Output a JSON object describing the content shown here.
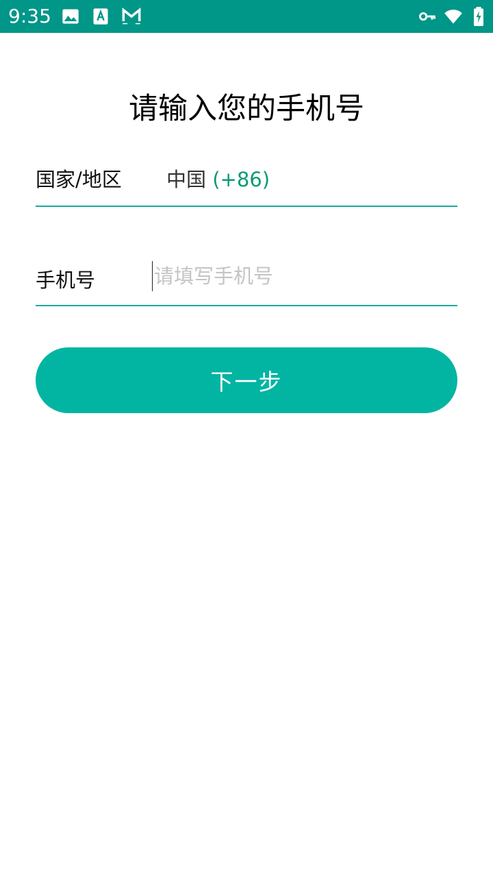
{
  "status_bar": {
    "time": "9:35",
    "background_color": "#009688",
    "left_icons": [
      "image-icon",
      "font-app-icon",
      "cat-mail-icon"
    ],
    "right_icons": [
      "vpn-key-icon",
      "wifi-icon",
      "battery-charging-icon"
    ]
  },
  "page": {
    "title": "请输入您的手机号"
  },
  "country_row": {
    "label": "国家/地区",
    "country_name": "中国",
    "country_code": "(+86)"
  },
  "phone_row": {
    "label": "手机号",
    "value": "",
    "placeholder": "请填写手机号"
  },
  "next_button": {
    "label": "下一步",
    "color": "#02b5a2"
  },
  "colors": {
    "accent": "#02b5a2",
    "underline": "#1aaa9b",
    "country_code": "#0a9a74"
  }
}
